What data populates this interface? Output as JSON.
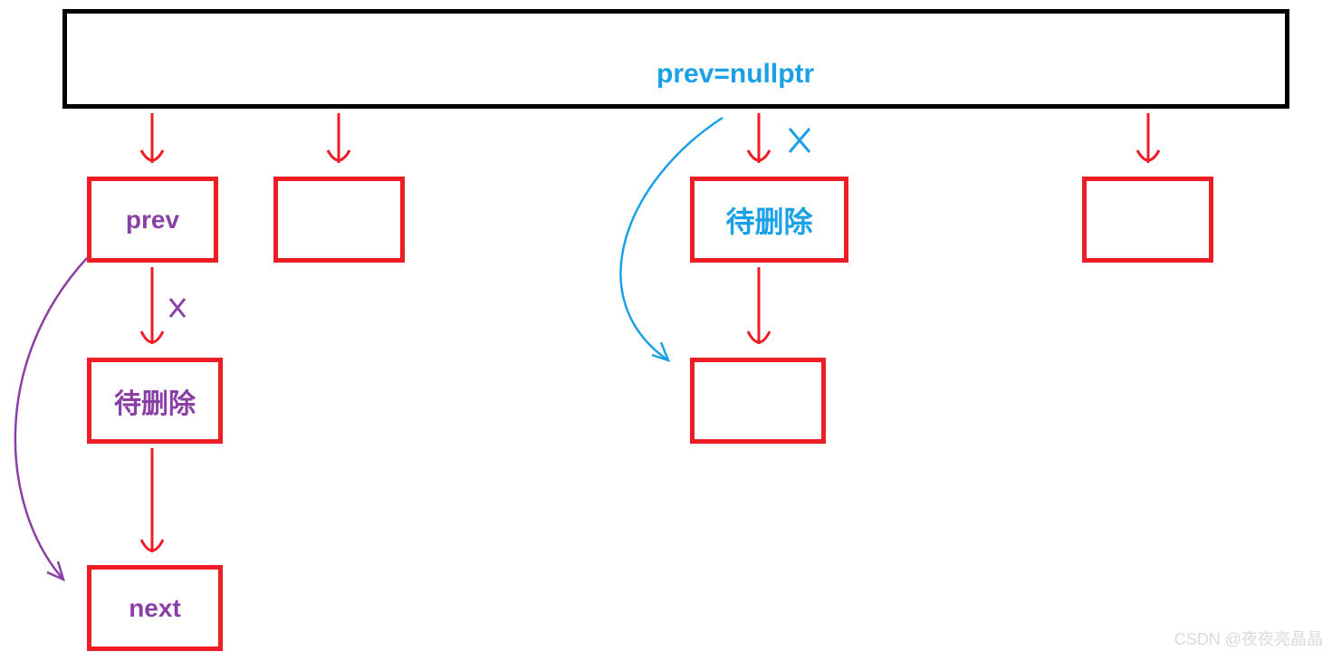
{
  "annotations": {
    "prev_nullptr": "prev=nullptr"
  },
  "nodes": {
    "prev": "prev",
    "to_delete_1": "待删除",
    "next": "next",
    "to_delete_2": "待删除"
  },
  "watermark": "CSDN @夜夜亮晶晶",
  "colors": {
    "red": "#ee1c25",
    "purple": "#8a3fa6",
    "blue": "#1aa0e6",
    "black": "#000000"
  }
}
